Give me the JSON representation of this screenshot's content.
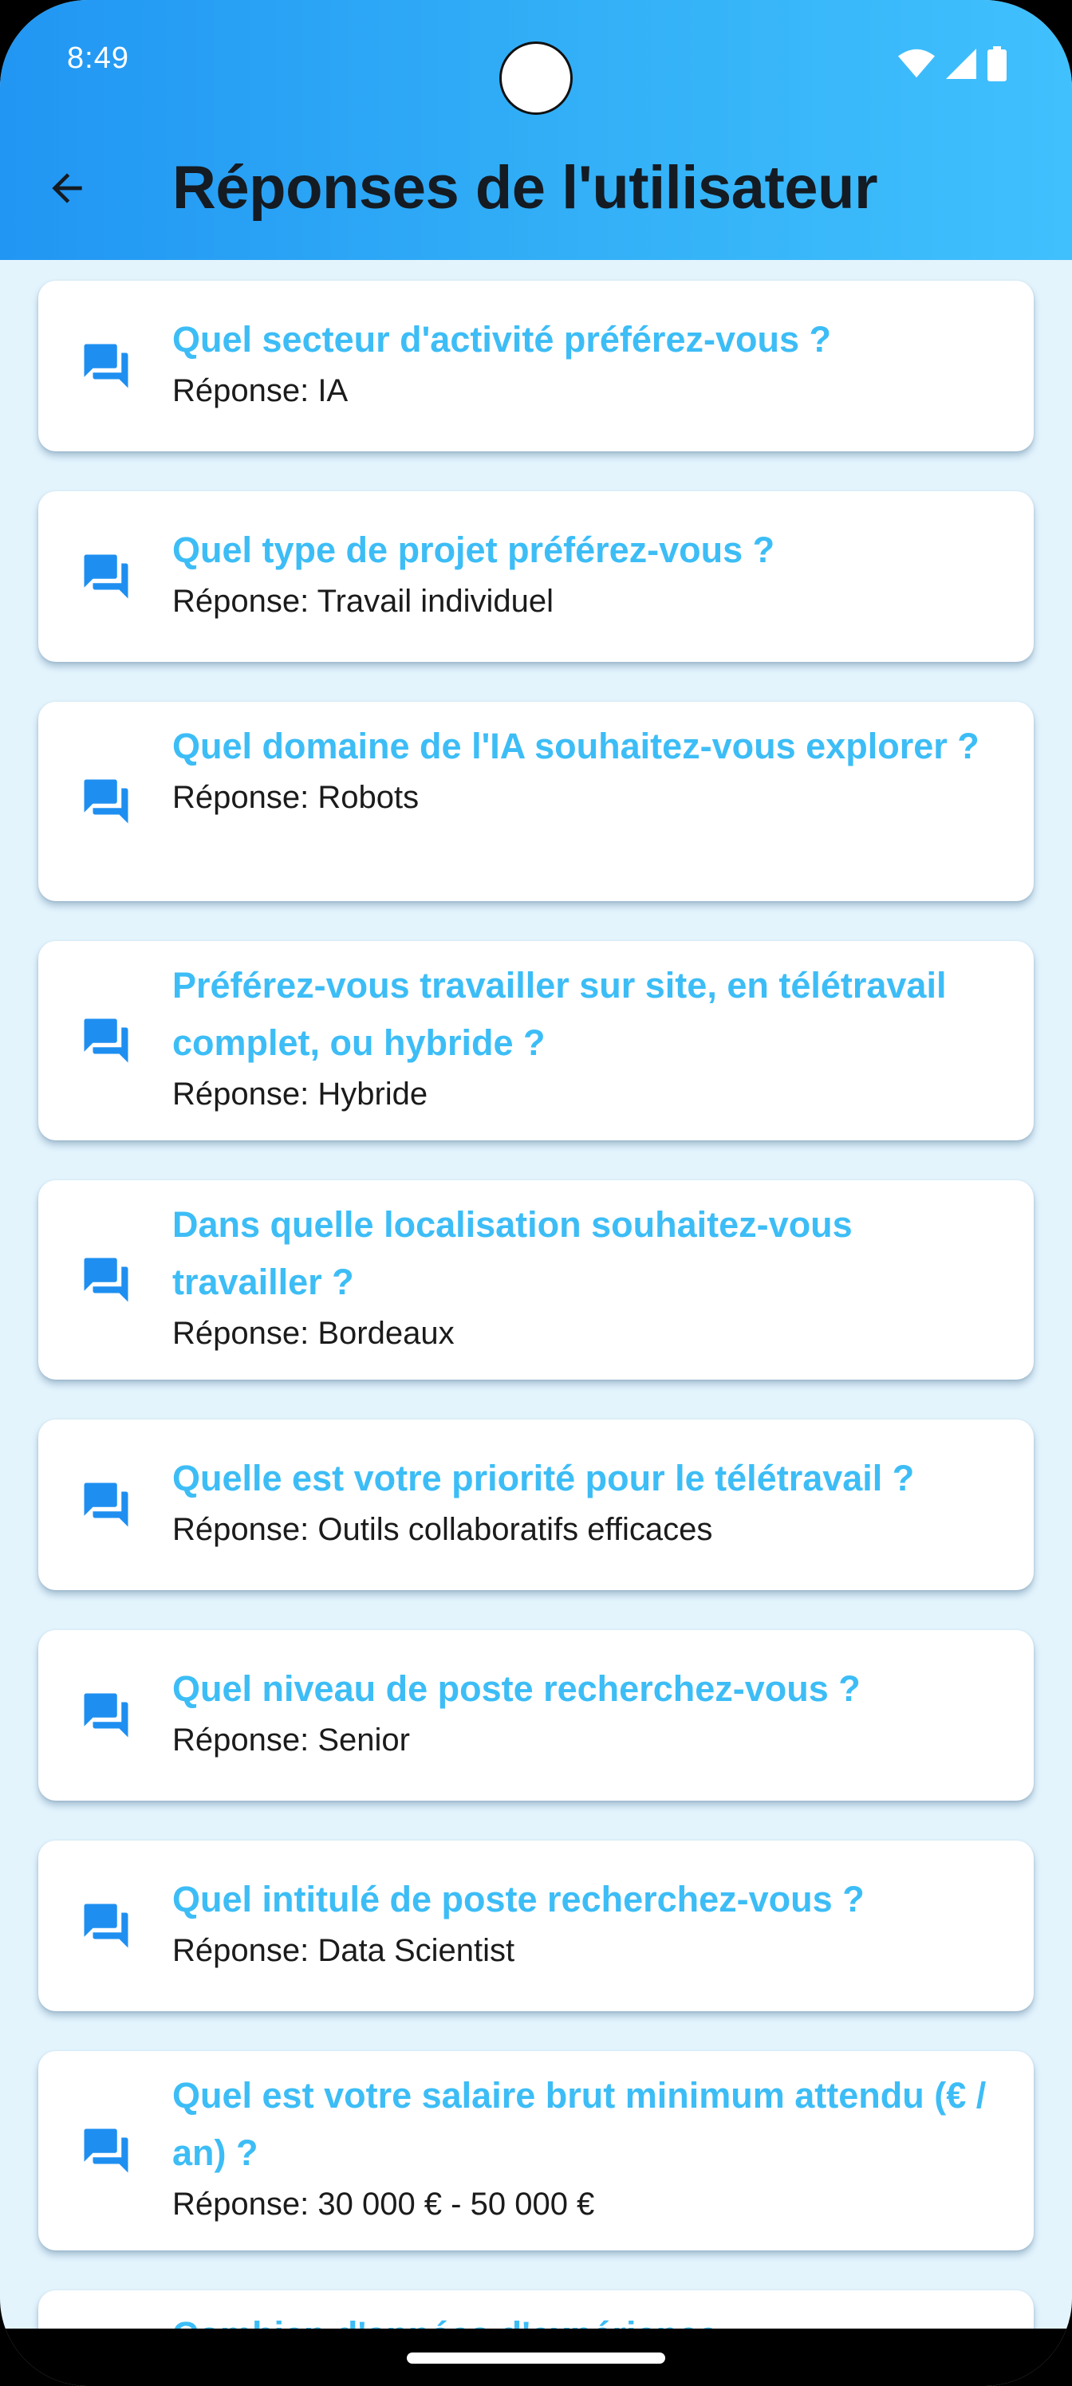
{
  "status_bar": {
    "time": "8:49",
    "icons": [
      "wifi-icon",
      "signal-icon",
      "battery-icon"
    ]
  },
  "app_bar": {
    "title": "Réponses de l'utilisateur",
    "back_icon": "arrow-back-icon"
  },
  "colors": {
    "header_gradient_start": "#2196f3",
    "header_gradient_end": "#40c0fd",
    "question_text": "#3dbdf6",
    "icon": "#1e8ff0",
    "background": "#e3f4fd",
    "card": "#ffffff"
  },
  "answer_prefix": "Réponse: ",
  "items": [
    {
      "question": "Quel secteur d'activité préférez-vous ?",
      "answer": "Réponse: IA"
    },
    {
      "question": "Quel type de projet préférez-vous ?",
      "answer": "Réponse: Travail individuel"
    },
    {
      "question": "Quel domaine de l'IA souhaitez-vous explorer ?",
      "answer": "Réponse: Robots"
    },
    {
      "question": "Préférez-vous travailler sur site, en télétravail complet, ou hybride ?",
      "answer": "Réponse: Hybride"
    },
    {
      "question": "Dans quelle localisation souhaitez-vous travailler ?",
      "answer": "Réponse: Bordeaux"
    },
    {
      "question": "Quelle est votre priorité pour le télétravail ?",
      "answer": "Réponse: Outils collaboratifs efficaces"
    },
    {
      "question": "Quel niveau de poste recherchez-vous ?",
      "answer": "Réponse: Senior"
    },
    {
      "question": "Quel intitulé de poste recherchez-vous ?",
      "answer": "Réponse: Data Scientist"
    },
    {
      "question": "Quel est votre salaire brut minimum attendu (€ / an) ?",
      "answer": "Réponse: 30 000 € - 50 000 €"
    },
    {
      "question": "Combien d'années d'expérience",
      "answer": ""
    }
  ]
}
